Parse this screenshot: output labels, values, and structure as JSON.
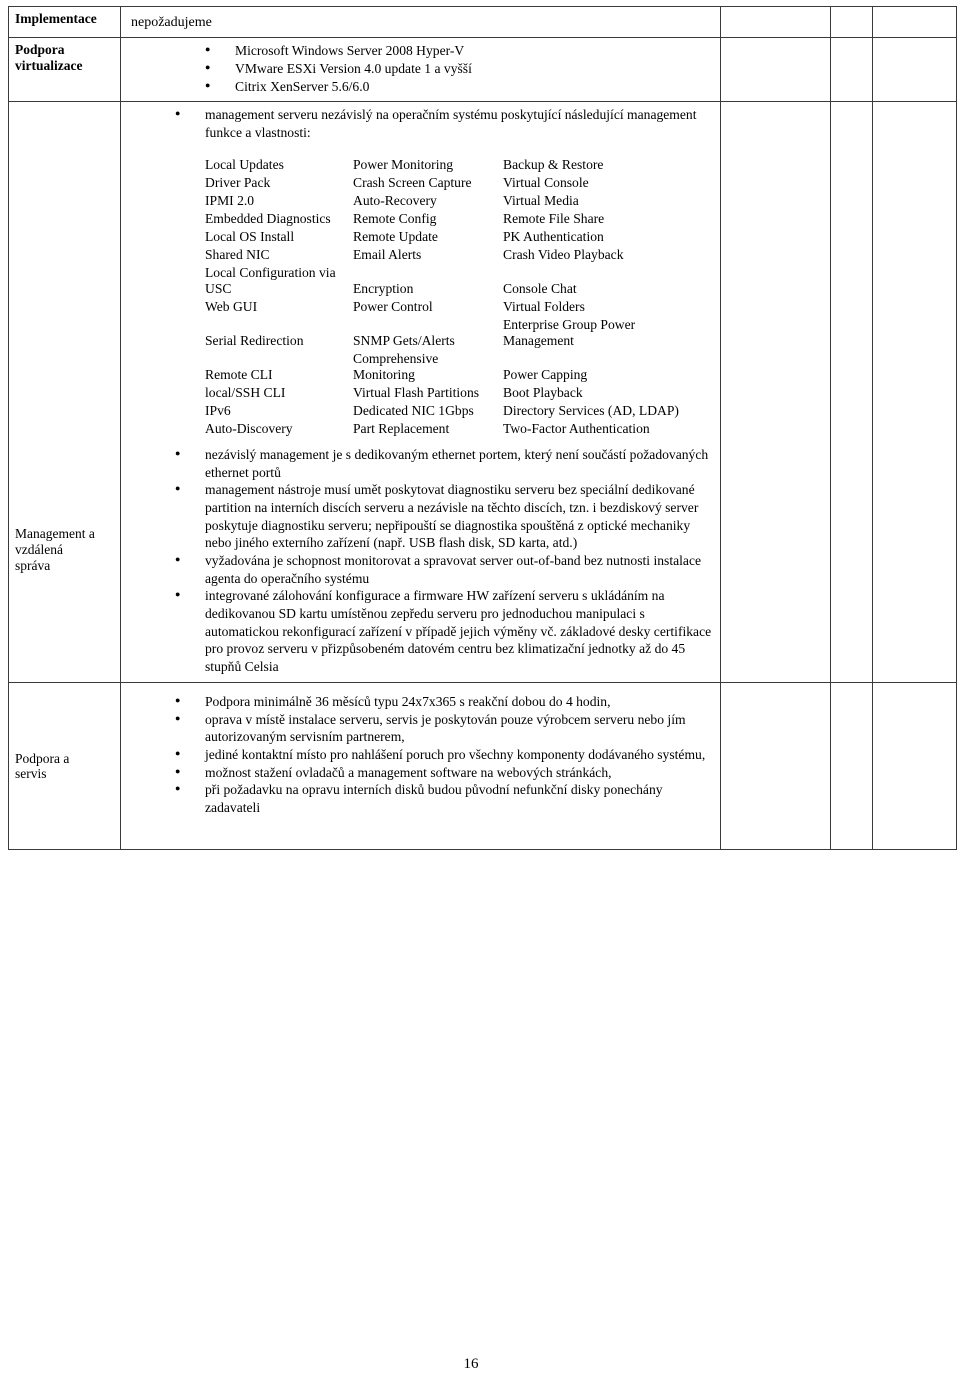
{
  "document": {
    "page_number": "16"
  },
  "table": {
    "rows": [
      {
        "label": "Implementace",
        "label_bold": true,
        "value": "nepožadujeme"
      },
      {
        "label_line1": "Podpora",
        "label_line2": "virtualizace",
        "label_bold": true,
        "bullets": [
          "Microsoft Windows Server 2008 Hyper-V",
          "VMware ESXi Version 4.0 update 1 a vyšší",
          "Citrix XenServer 5.6/6.0"
        ]
      },
      {
        "label_line1": "Management a",
        "label_line2": "vzdálená",
        "label_line3": "správa",
        "label_bold": false,
        "intro_bullet": "management serveru nezávislý na operačním systému poskytující následující management funkce a vlastnosti:",
        "feature_grid": {
          "columns": 3,
          "rows": [
            [
              "Local Updates",
              "Power Monitoring",
              "Backup & Restore"
            ],
            [
              "Driver Pack",
              "Crash Screen Capture",
              "Virtual Console"
            ],
            [
              "IPMI 2.0",
              "Auto-Recovery",
              "Virtual Media"
            ],
            [
              "Embedded Diagnostics",
              "Remote Config",
              "Remote File Share"
            ],
            [
              "Local OS Install",
              "Remote Update",
              "PK Authentication"
            ],
            [
              "Shared NIC",
              "Email Alerts",
              "Crash Video Playback"
            ],
            [
              "Local Configuration via USC",
              "Encryption",
              "Console Chat"
            ],
            [
              "Web GUI",
              "Power Control",
              "Virtual Folders"
            ],
            [
              "Serial Redirection",
              "SNMP Gets/Alerts",
              "Enterprise Group Power Management"
            ],
            [
              "Remote CLI",
              "Comprehensive Monitoring",
              "Power Capping"
            ],
            [
              "local/SSH CLI",
              "Virtual Flash Partitions",
              "Boot Playback"
            ],
            [
              "IPv6",
              "Dedicated NIC 1Gbps",
              "Directory Services (AD, LDAP)"
            ],
            [
              "Auto-Discovery",
              "Part Replacement",
              "Two-Factor Authentication"
            ]
          ]
        },
        "bullets": [
          "nezávislý management je s dedikovaným ethernet portem, který není součástí požadovaných ethernet portů",
          "management nástroje musí umět poskytovat diagnostiku serveru bez speciální dedikované partition na interních discích serveru a nezávisle na těchto discích, tzn. i bezdiskový server poskytuje diagnostiku serveru; nepřipouští se diagnostika spouštěná z optické mechaniky nebo jiného externího zařízení (např. USB flash disk, SD karta, atd.)",
          "vyžadována je schopnost monitorovat a spravovat server out-of-band bez nutnosti instalace agenta do operačního systému",
          "integrované zálohování konfigurace a firmware HW zařízení serveru s ukládáním na dedikovanou SD kartu umístěnou zepředu serveru pro jednoduchou manipulaci s automatickou rekonfigurací zařízení v případě jejich výměny vč. základové desky certifikace pro provoz serveru v přizpůsobeném datovém centru bez klimatizační jednotky až do 45 stupňů Celsia"
        ]
      },
      {
        "label_line1": "Podpora a",
        "label_line2": "servis",
        "label_bold": false,
        "bullets": [
          "Podpora minimálně 36 měsíců typu 24x7x365 s reakční dobou do 4 hodin,",
          "oprava v místě instalace serveru, servis je poskytován pouze výrobcem serveru nebo jím autorizovaným servisním partnerem,",
          "jediné kontaktní místo pro nahlášení poruch pro všechny komponenty dodávaného systému,",
          "možnost stažení ovladačů a management software na webových stránkách,",
          "při požadavku na opravu interních disků budou původní nefunkční disky ponechány zadavateli"
        ]
      }
    ]
  }
}
